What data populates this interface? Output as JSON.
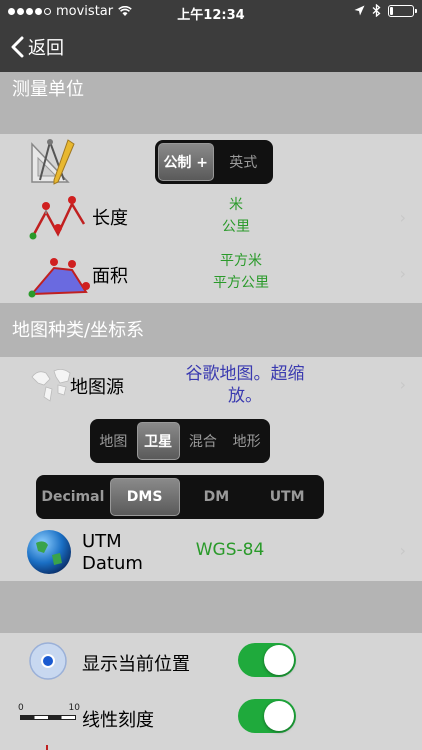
{
  "status_bar": {
    "carrier": "movistar",
    "time": "上午12:34"
  },
  "nav": {
    "back_label": "返回"
  },
  "units_section": {
    "header": "测量单位",
    "system_options": [
      "公制 +",
      "英式"
    ],
    "length": {
      "label": "长度",
      "values": [
        "米",
        "公里"
      ]
    },
    "area": {
      "label": "面积",
      "values": [
        "平方米",
        "平方公里"
      ]
    }
  },
  "map_section": {
    "header": "地图种类/坐标系",
    "source": {
      "label": "地图源",
      "value": "谷歌地图。超缩放。"
    },
    "map_types": [
      "地图",
      "卫星",
      "混合",
      "地形"
    ],
    "coord_formats": [
      "Decimal",
      "DMS",
      "DM",
      "UTM"
    ],
    "utm": {
      "label_line1": "UTM",
      "label_line2": "Datum",
      "value": "WGS-84"
    }
  },
  "toggles": {
    "show_location": "显示当前位置",
    "scale_bar": "线性刻度",
    "scale_labels": [
      "0",
      "10"
    ]
  },
  "colors": {
    "accent_green": "#1faa3c",
    "value_green": "#2a9a2a",
    "value_blue": "#3a3ab0"
  }
}
